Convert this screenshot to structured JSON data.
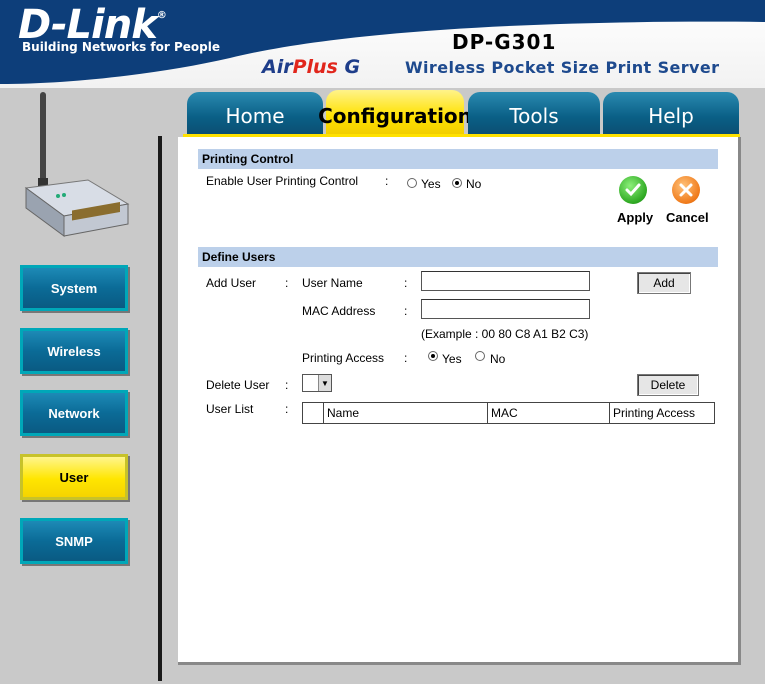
{
  "header": {
    "brand": "D-Link",
    "tagline": "Building Networks for People",
    "model": "DP-G301",
    "airplus_air": "Air",
    "airplus_plus": "Plus",
    "airplus_g": "G",
    "product": "Wireless Pocket Size Print Server"
  },
  "tabs": [
    {
      "label": "Home"
    },
    {
      "label": "Configuration"
    },
    {
      "label": "Tools"
    },
    {
      "label": "Help"
    }
  ],
  "nav": [
    {
      "label": "System"
    },
    {
      "label": "Wireless"
    },
    {
      "label": "Network"
    },
    {
      "label": "User"
    },
    {
      "label": "SNMP"
    }
  ],
  "printing_control": {
    "title": "Printing Control",
    "enable_label": "Enable User Printing Control",
    "colon": ":",
    "yes": "Yes",
    "no": "No",
    "selected": "No",
    "apply": "Apply",
    "cancel": "Cancel"
  },
  "define_users": {
    "title": "Define Users",
    "add_user_label": "Add User",
    "user_name_label": "User Name",
    "user_name_value": "",
    "mac_label": "MAC Address",
    "mac_value": "",
    "mac_example": "(Example : 00 80 C8 A1 B2 C3)",
    "printing_access_label": "Printing Access",
    "access_yes": "Yes",
    "access_no": "No",
    "access_selected": "Yes",
    "add_button": "Add",
    "delete_user_label": "Delete User",
    "delete_button": "Delete",
    "user_list_label": "User List",
    "columns": [
      "Name",
      "MAC",
      "Printing Access"
    ]
  },
  "colors": {
    "header_blue": "#0d3e7a",
    "tab_blue": "#0a5f86",
    "active_yellow": "#ffe100",
    "section_bar": "#bcd0ea"
  }
}
